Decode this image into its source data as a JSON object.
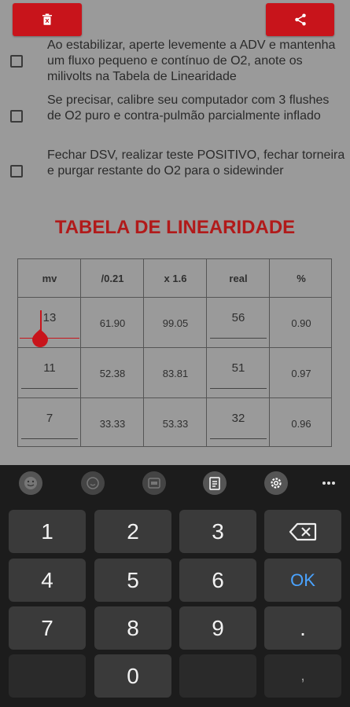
{
  "checklist": [
    {
      "text": "Ao estabilizar, aperte levemente a ADV e mantenha um fluxo pequeno e contínuo de O2, anote os milivolts na Tabela de Linearidade"
    },
    {
      "text": "Se precisar, calibre seu computador com 3 flushes de O2 puro e contra-pulmão parcialmente inflado"
    },
    {
      "text": "Fechar DSV, realizar teste POSITIVO, fechar torneira e purgar restante do O2 para o sidewinder"
    }
  ],
  "table": {
    "title": "TABELA DE LINEARIDADE",
    "headers": [
      "mv",
      "/0.21",
      "x 1.6",
      "real",
      "%"
    ],
    "rows": [
      [
        "13",
        "61.90",
        "99.05",
        "56",
        "0.90"
      ],
      [
        "11",
        "52.38",
        "83.81",
        "51",
        "0.97"
      ],
      [
        "7",
        "33.33",
        "53.33",
        "32",
        "0.96"
      ]
    ]
  },
  "keyboard": {
    "keys": [
      "1",
      "2",
      "3",
      "4",
      "5",
      "6",
      "OK",
      "7",
      "8",
      "9",
      ".",
      "0",
      ","
    ]
  },
  "colors": {
    "accent": "#c8141b",
    "title": "#b11a1a",
    "ok": "#4aa3ff"
  }
}
